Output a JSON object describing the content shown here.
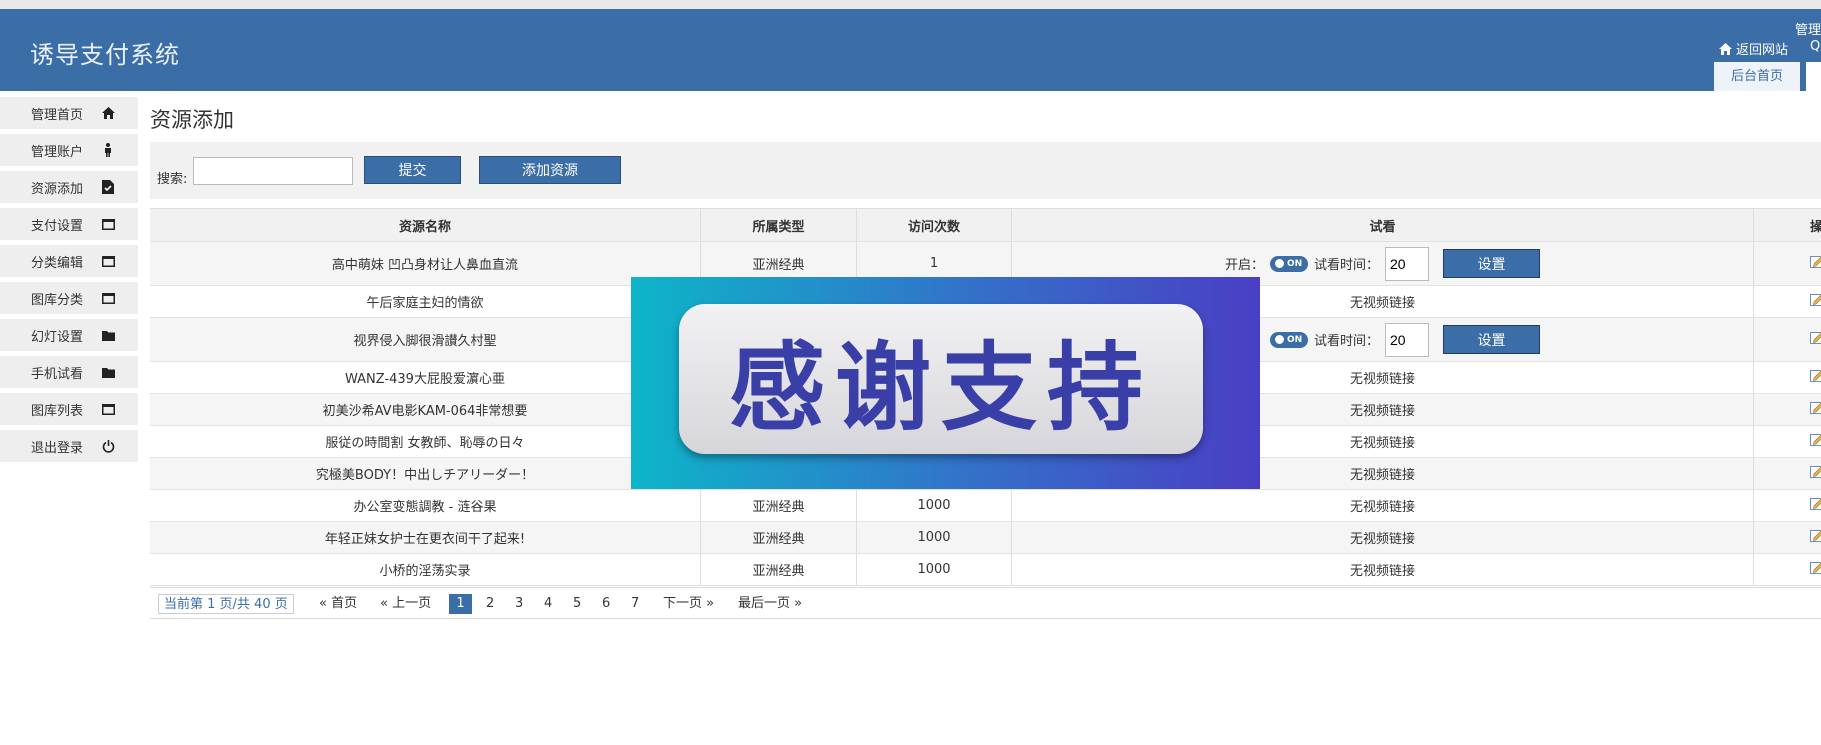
{
  "header": {
    "brand": "诱导支付系统",
    "admin_label": "管理",
    "return_site": "返回网站",
    "q_glyph": "Q",
    "tab_home": "后台首页"
  },
  "sidebar": {
    "items": [
      {
        "label": "管理首页",
        "icon": "home-icon"
      },
      {
        "label": "管理账户",
        "icon": "user-icon"
      },
      {
        "label": "资源添加",
        "icon": "document-check-icon"
      },
      {
        "label": "支付设置",
        "icon": "window-icon"
      },
      {
        "label": "分类编辑",
        "icon": "window-icon"
      },
      {
        "label": "图库分类",
        "icon": "window-icon"
      },
      {
        "label": "幻灯设置",
        "icon": "folder-icon"
      },
      {
        "label": "手机试看",
        "icon": "folder-icon"
      },
      {
        "label": "图库列表",
        "icon": "window-icon"
      },
      {
        "label": "退出登录",
        "icon": "power-icon"
      }
    ]
  },
  "page": {
    "title": "资源添加"
  },
  "search": {
    "label": "搜索:",
    "value": "",
    "submit": "提交",
    "add": "添加资源"
  },
  "table": {
    "headers": [
      "资源名称",
      "所属类型",
      "访问次数",
      "试看",
      "操"
    ],
    "trial_open_label": "开启：",
    "toggle_text": "ON",
    "trial_time_label": "试看时间：",
    "set_label": "设置",
    "rows": [
      {
        "name": "高中萌妹 凹凸身材让人鼻血直流",
        "type": "亚洲经典",
        "visits": "1",
        "trial": "control",
        "time": "20"
      },
      {
        "name": "午后家庭主妇的情欲",
        "type": "",
        "visits": "",
        "trial": "无视频链接"
      },
      {
        "name": "视界侵入脚很滑讃久村聖",
        "type": "",
        "visits": "",
        "trial": "control",
        "time": "20"
      },
      {
        "name": "WANZ-439大屁股爱濵心亜",
        "type": "",
        "visits": "",
        "trial": "无视频链接"
      },
      {
        "name": "初美沙希AV电影KAM-064非常想要",
        "type": "",
        "visits": "",
        "trial": "无视频链接"
      },
      {
        "name": "服従の時間割 女教師、恥辱の日々",
        "type": "",
        "visits": "",
        "trial": "无视频链接"
      },
      {
        "name": "究極美BODY！中出しチアリーダー！",
        "type": "",
        "visits": "",
        "trial": "无视频链接"
      },
      {
        "name": "办公室变態調教 - 涟谷果",
        "type": "亚洲经典",
        "visits": "1000",
        "trial": "无视频链接"
      },
      {
        "name": "年轻正妹女护士在更衣间干了起来!",
        "type": "亚洲经典",
        "visits": "1000",
        "trial": "无视频链接"
      },
      {
        "name": "小桥的淫荡实录",
        "type": "亚洲经典",
        "visits": "1000",
        "trial": "无视频链接"
      }
    ]
  },
  "pager": {
    "info": "当前第 1 页/共 40 页",
    "first": "« 首页",
    "prev": "« 上一页",
    "pages": [
      "1",
      "2",
      "3",
      "4",
      "5",
      "6",
      "7"
    ],
    "current": "1",
    "next": "下一页 »",
    "last": "最后一页 »"
  },
  "overlay": {
    "text": "感谢支持"
  },
  "colors": {
    "brand": "#3b6da7",
    "panel": "#f1f1f1"
  }
}
